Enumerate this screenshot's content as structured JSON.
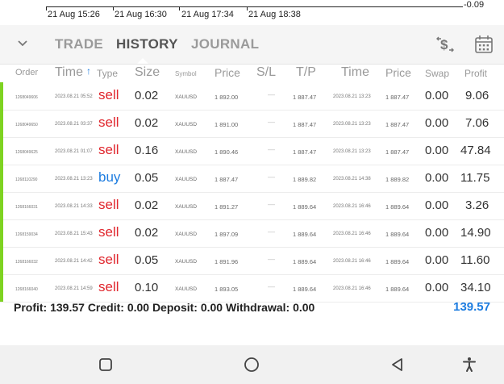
{
  "chart": {
    "time_labels": [
      "21 Aug 15:26",
      "21 Aug 16:30",
      "21 Aug 17:34",
      "21 Aug 18:38"
    ],
    "price_label": "-0.09"
  },
  "tabs": {
    "trade": "TRADE",
    "history": "HISTORY",
    "journal": "JOURNAL",
    "active": "history"
  },
  "icons": {
    "collapse": "chevron-down-icon",
    "currency": "dollar-exchange-icon",
    "calendar": "calendar-icon"
  },
  "columns": {
    "order": "Order",
    "time": "Time",
    "sort_arrow": "↑",
    "type": "Type",
    "size": "Size",
    "symbol": "Symbol",
    "price": "Price",
    "sl": "S/L",
    "tp": "T/P",
    "close_time": "Time",
    "close_price": "Price",
    "swap": "Swap",
    "profit": "Profit"
  },
  "rows": [
    {
      "order": "1268049606",
      "time": "2023.08.21 05:52",
      "type": "sell",
      "size": "0.02",
      "symbol": "XAUUSD",
      "price": "1 892.00",
      "sl": "—",
      "tp": "1 887.47",
      "close_time": "2023.08.21 13:23",
      "close_price": "1 887.47",
      "swap": "0.00",
      "profit": "9.06"
    },
    {
      "order": "1268049650",
      "time": "2023.08.21 03:37",
      "type": "sell",
      "size": "0.02",
      "symbol": "XAUUSD",
      "price": "1 891.00",
      "sl": "—",
      "tp": "1 887.47",
      "close_time": "2023.08.21 13:23",
      "close_price": "1 887.47",
      "swap": "0.00",
      "profit": "7.06"
    },
    {
      "order": "1268049625",
      "time": "2023.08.21 01:07",
      "type": "sell",
      "size": "0.16",
      "symbol": "XAUUSD",
      "price": "1 890.46",
      "sl": "—",
      "tp": "1 887.47",
      "close_time": "2023.08.21 13:23",
      "close_price": "1 887.47",
      "swap": "0.00",
      "profit": "47.84"
    },
    {
      "order": "1268110290",
      "time": "2023.08.21 13:23",
      "type": "buy",
      "size": "0.05",
      "symbol": "XAUUSD",
      "price": "1 887.47",
      "sl": "—",
      "tp": "1 889.82",
      "close_time": "2023.08.21 14:38",
      "close_price": "1 889.82",
      "swap": "0.00",
      "profit": "11.75"
    },
    {
      "order": "1268166031",
      "time": "2023.08.21 14:33",
      "type": "sell",
      "size": "0.02",
      "symbol": "XAUUSD",
      "price": "1 891.27",
      "sl": "—",
      "tp": "1 889.64",
      "close_time": "2023.08.21 16:46",
      "close_price": "1 889.64",
      "swap": "0.00",
      "profit": "3.26"
    },
    {
      "order": "1268159034",
      "time": "2023.08.21 15:43",
      "type": "sell",
      "size": "0.02",
      "symbol": "XAUUSD",
      "price": "1 897.09",
      "sl": "—",
      "tp": "1 889.64",
      "close_time": "2023.08.21 16:46",
      "close_price": "1 889.64",
      "swap": "0.00",
      "profit": "14.90"
    },
    {
      "order": "1268166032",
      "time": "2023.08.21 14:42",
      "type": "sell",
      "size": "0.05",
      "symbol": "XAUUSD",
      "price": "1 891.96",
      "sl": "—",
      "tp": "1 889.64",
      "close_time": "2023.08.21 16:46",
      "close_price": "1 889.64",
      "swap": "0.00",
      "profit": "11.60"
    },
    {
      "order": "1268166040",
      "time": "2023.08.21 14:59",
      "type": "sell",
      "size": "0.10",
      "symbol": "XAUUSD",
      "price": "1 893.05",
      "sl": "—",
      "tp": "1 889.64",
      "close_time": "2023.08.21 16:46",
      "close_price": "1 889.64",
      "swap": "0.00",
      "profit": "34.10"
    }
  ],
  "summary": {
    "text": "Profit: 139.57  Credit: 0.00  Deposit: 0.00  Withdrawal: 0.00",
    "total": "139.57"
  },
  "nav": {
    "recents": "recents-square-icon",
    "home": "home-circle-icon",
    "back": "back-triangle-icon",
    "accessibility": "accessibility-icon"
  },
  "colors": {
    "sell": "#e0262d",
    "buy": "#1e7de0",
    "accent_bar": "#7ed321",
    "total": "#1e7de0"
  }
}
